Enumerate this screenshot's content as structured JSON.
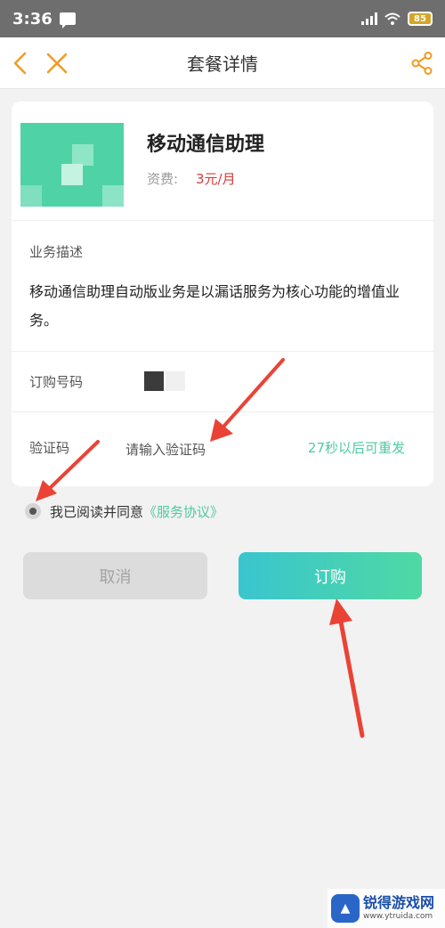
{
  "status_bar": {
    "time": "3:36",
    "battery": "85",
    "icons": [
      "message-icon",
      "signal-icon",
      "wifi-icon",
      "battery-icon"
    ]
  },
  "nav": {
    "title": "套餐详情",
    "icons": [
      "back-icon",
      "close-icon",
      "share-icon"
    ],
    "accent_color": "#f29a21"
  },
  "product": {
    "name": "移动通信助理",
    "fee_label": "资费:",
    "fee_value": "3元/月"
  },
  "description": {
    "label": "业务描述",
    "text": "移动通信助理自动版业务是以漏话服务为核心功能的增值业务。"
  },
  "order_number": {
    "label": "订购号码"
  },
  "verification": {
    "label": "验证码",
    "placeholder": "请输入验证码",
    "resend_text": "27秒以后可重发"
  },
  "agreement": {
    "text": "我已阅读并同意",
    "link": "《服务协议》"
  },
  "buttons": {
    "cancel": "取消",
    "order": "订购"
  },
  "watermark": {
    "name": "锐得游戏网",
    "url": "www.ytruida.com"
  },
  "colors": {
    "accent_green": "#4fcaa0",
    "fee_red": "#d93a3a",
    "annotation_red": "#ea4335"
  }
}
